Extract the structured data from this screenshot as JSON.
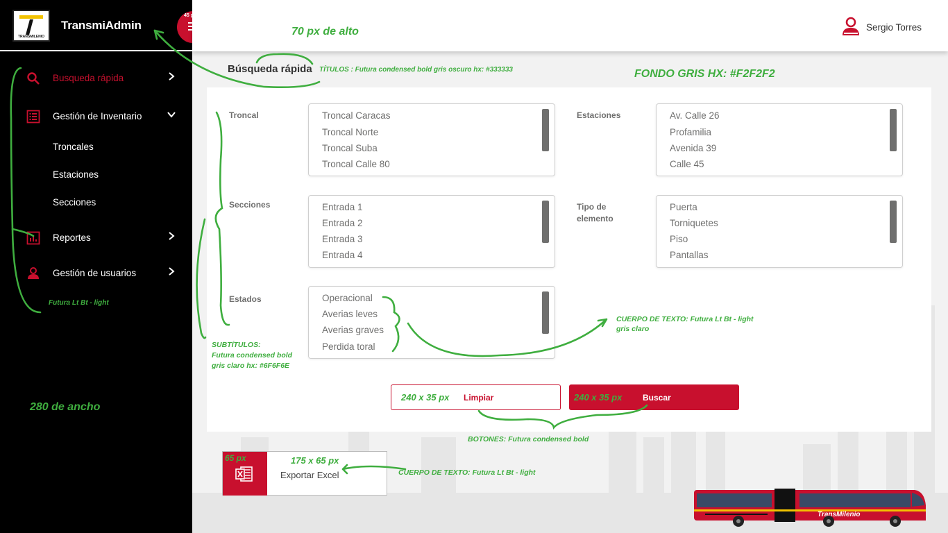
{
  "app": {
    "title": "TransmiAdmin",
    "logo_text": "TRANSMILENIO",
    "menu_size_tag": "45 px"
  },
  "sidebar": {
    "items": [
      {
        "label": "Busqueda rápida",
        "icon": "search-icon",
        "active": true
      },
      {
        "label": "Gestión de Inventario",
        "icon": "list-icon",
        "expanded": true
      },
      {
        "label": "Reportes",
        "icon": "chart-icon"
      },
      {
        "label": "Gestión de usuarios",
        "icon": "user-icon"
      }
    ],
    "subitems": [
      "Troncales",
      "Estaciones",
      "Secciones"
    ]
  },
  "header": {
    "user_name": "Sergio Torres"
  },
  "main": {
    "title": "Búsqueda rápida",
    "fields": {
      "troncal": {
        "label": "Troncal",
        "options": [
          "Troncal Caracas",
          "Troncal Norte",
          "Troncal Suba",
          "Troncal Calle 80"
        ]
      },
      "estaciones": {
        "label": "Estaciones",
        "options": [
          "Av. Calle 26",
          "Profamilia",
          "Avenida 39",
          "Calle 45"
        ]
      },
      "secciones": {
        "label": "Secciones",
        "options": [
          "Entrada 1",
          "Entrada 2",
          "Entrada 3",
          "Entrada 4"
        ]
      },
      "tipo": {
        "label_line1": "Tipo de",
        "label_line2": "elemento",
        "options": [
          "Puerta",
          "Torniquetes",
          "Piso",
          "Pantallas"
        ]
      },
      "estados": {
        "label": "Estados",
        "options": [
          "Operacional",
          "Averias leves",
          "Averias graves",
          "Perdida toral"
        ]
      }
    },
    "buttons": {
      "clear": "Limpiar",
      "search": "Buscar",
      "size_note": "240 x 35 px"
    },
    "export": {
      "label": "Exportar Excel",
      "size_note": "175 x 65 px",
      "side_note": "65 px"
    }
  },
  "annotations": {
    "header_height": "70 px de alto",
    "titles": "TÍTULOS : Futura condensed bold gris oscuro hx: #333333",
    "background": "FONDO GRIS  HX:  #F2F2F2",
    "menu_font": "Futura Lt Bt - light",
    "subtitles_1": "SUBTÍTULOS:",
    "subtitles_2": "Futura condensed bold",
    "subtitles_3": "gris claro hx: #6F6F6E",
    "body_text_1": "CUERPO DE TEXTO: Futura Lt Bt - light",
    "body_text_2": "gris claro",
    "sidebar_width": "280 de ancho",
    "buttons": "BOTONES: Futura condensed bold",
    "body_text_export": "CUERPO DE TEXTO: Futura Lt Bt - light"
  },
  "colors": {
    "accent": "#c8102e",
    "sidebar": "#000000",
    "background": "#f2f2f2",
    "title": "#333333",
    "subtitle": "#6f6f6e",
    "annotation": "#3fae3f"
  }
}
